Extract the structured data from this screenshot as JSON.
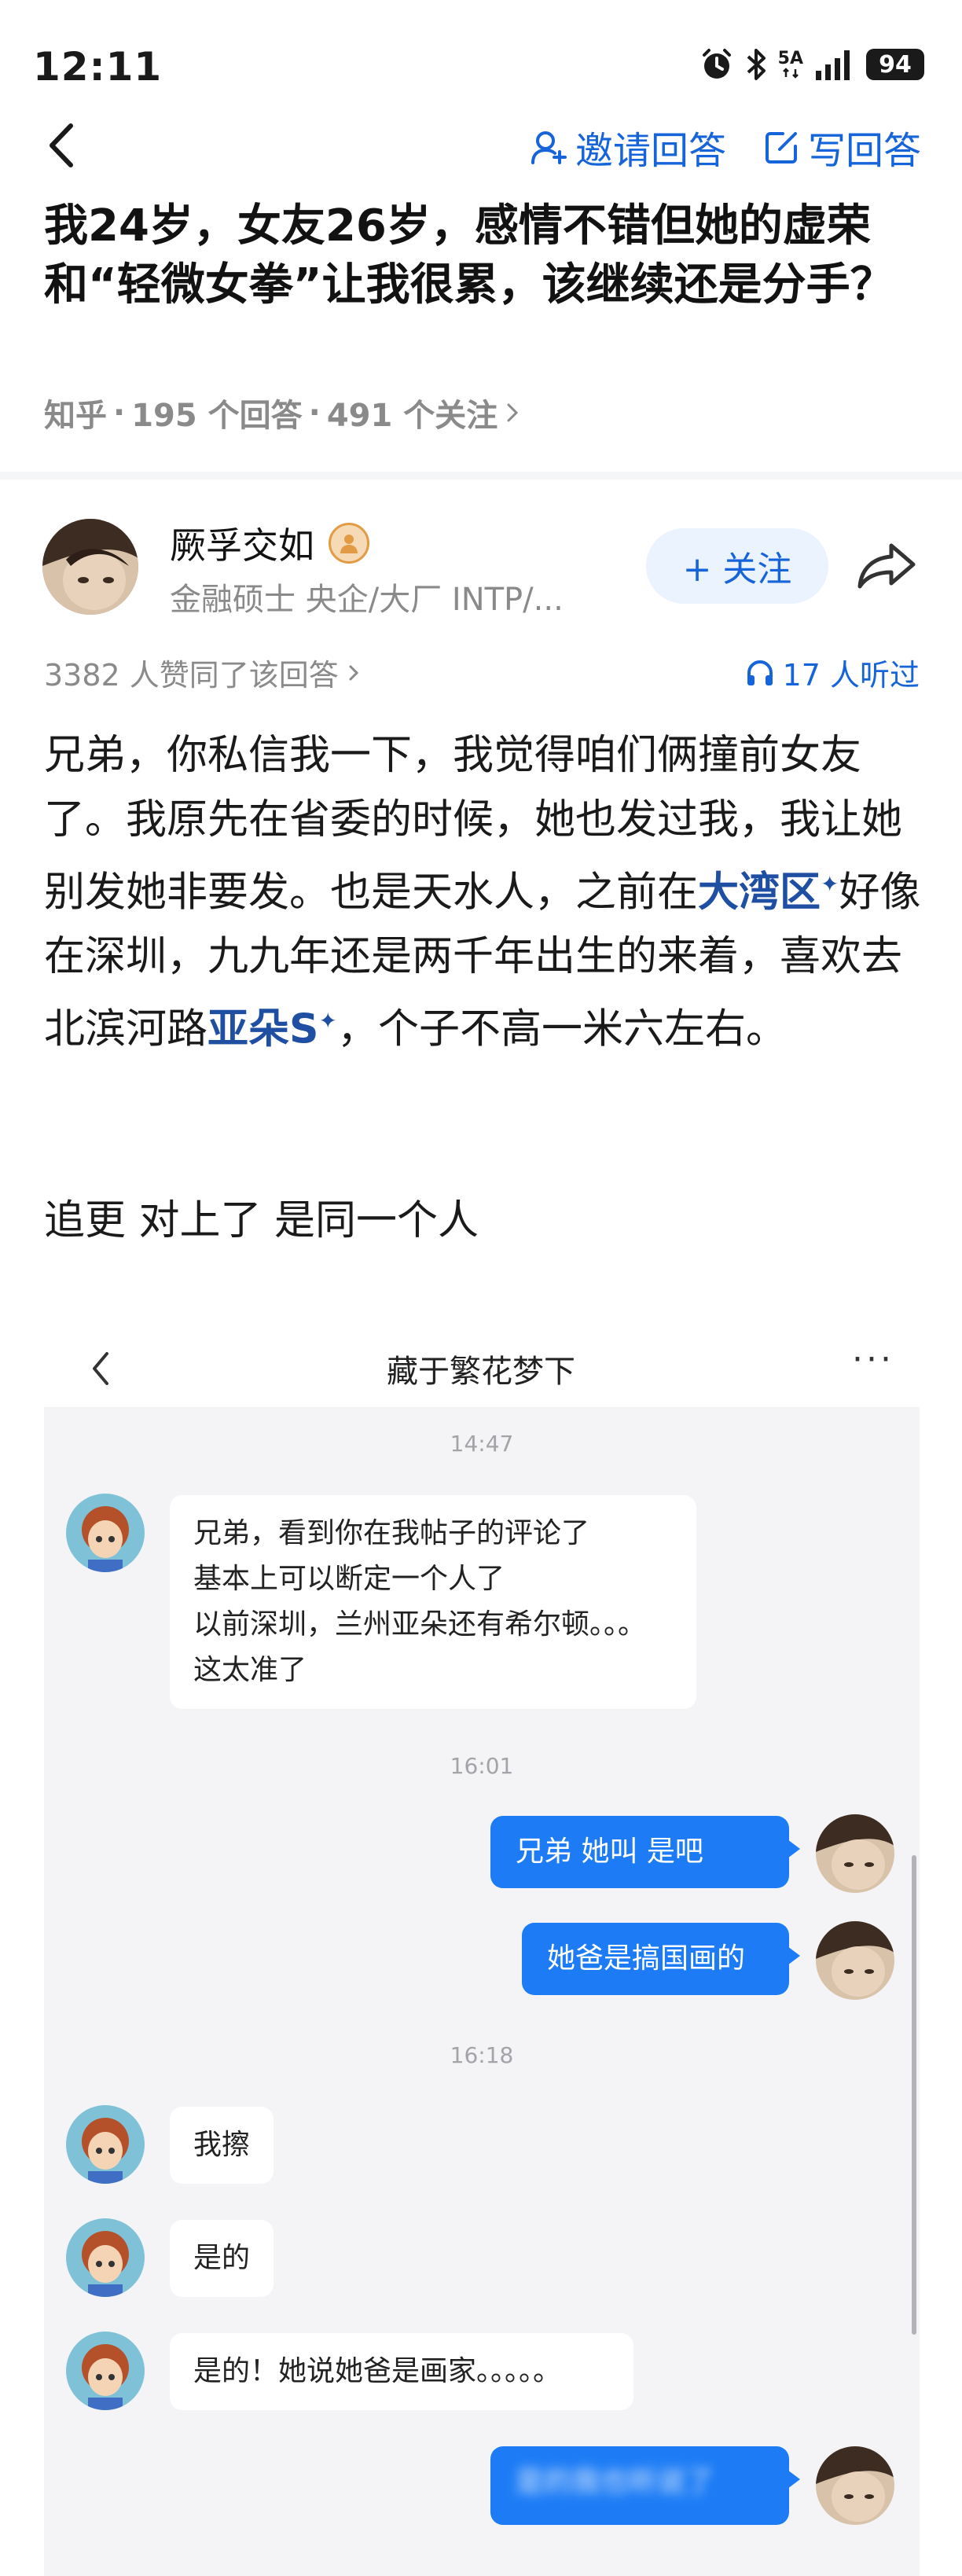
{
  "status_bar": {
    "time": "12:11",
    "network": "5A",
    "battery": "94"
  },
  "nav": {
    "invite_label": "邀请回答",
    "write_label": "写回答"
  },
  "question": {
    "title": "我24岁，女友26岁，感情不错但她的虚荣和“轻微女拳”让我很累，该继续还是分手？",
    "site": "知乎",
    "answers": "195 个回答",
    "followers": "491 个关注",
    "sep": "·"
  },
  "author": {
    "name": "厥孚交如",
    "description": "金融硕士 央企/大厂 INTP/...",
    "follow_label": "+ 关注",
    "votes_text": "3382 人赞同了该回答",
    "listen_text": "17 人听过"
  },
  "answer": {
    "p1_a": "兄弟，你私信我一下，我觉得咱们俩撞前女友了。我原先在省委的时候，她也发过我，我让她别发她非要发。也是天水人，之前在",
    "link1": "大湾区",
    "p1_b": "好像在深圳，九九年还是两千年出生的来着，喜欢去北滨河路",
    "link2": "亚朵S",
    "p1_c": "，个子不高一米六左右。",
    "update": "追更 对上了 是同一个人"
  },
  "chat": {
    "title": "藏于繁花梦下",
    "more": "···",
    "times": [
      "14:47",
      "16:01",
      "16:18"
    ],
    "msg1_lines": [
      "兄弟，看到你在我帖子的评论了",
      "基本上可以断定一个人了",
      "以前深圳，兰州亚朵还有希尔顿。。。",
      "这太准了"
    ],
    "msg2": "兄弟 她叫      是吧",
    "msg3": "她爸是搞国画的",
    "msg4": "我擦",
    "msg5": "是的",
    "msg6": "是的！她说她爸是画家。。。。。",
    "msg7": "是的我也听说了"
  },
  "colors": {
    "accent": "#1664d9",
    "bubble_blue": "#1d7cf5",
    "chat_bg": "#f4f4f6"
  }
}
